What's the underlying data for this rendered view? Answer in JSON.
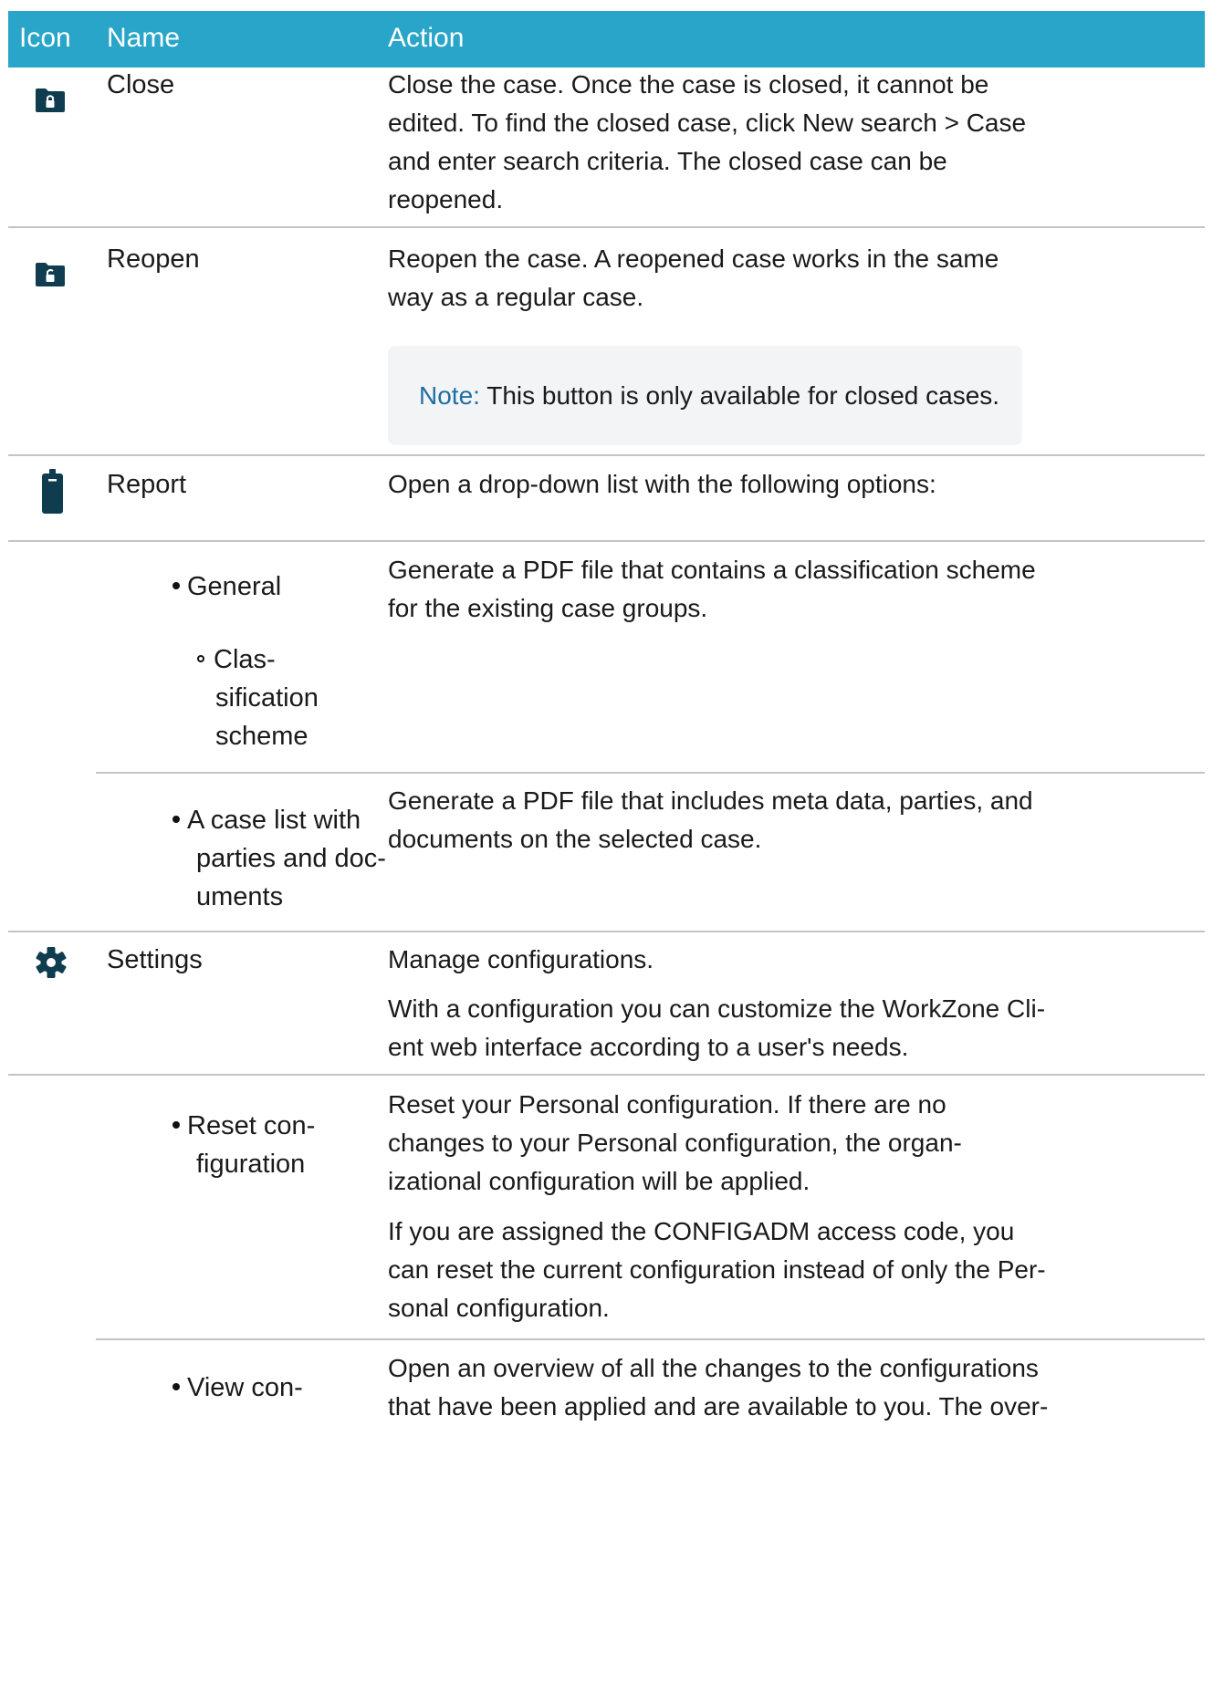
{
  "header": {
    "icon": "Icon",
    "name": "Name",
    "action": "Action"
  },
  "icons": {
    "close": "lock-folder-icon",
    "reopen": "unlock-folder-icon",
    "report": "clipboard-icon",
    "settings": "gear-icon"
  },
  "colors": {
    "header_bg": "#29a5c9",
    "icon": "#0f3d4f",
    "note_label": "#1f6fa3",
    "note_bg": "#f3f4f6"
  },
  "rows": {
    "close": {
      "name": "Close",
      "action": {
        "l1": "Close the case. Once the case is closed, it cannot be",
        "l2_pre": "edited. To find the closed case, click ",
        "l2_bold": "New search > Case",
        "l3": "and enter search criteria. The closed case can be",
        "l4": "reopened."
      }
    },
    "reopen": {
      "name": "Reopen",
      "action": {
        "l1": "Reopen the case. A reopened case works in the same",
        "l2": "way as a regular case."
      },
      "note_label": "Note:",
      "note_text": " This button is only available for closed cases."
    },
    "report": {
      "name": "Report",
      "action": "Open a drop-down list with the following options:"
    },
    "general": {
      "name": "General",
      "sub": {
        "l1": "Clas-",
        "l2": "sification",
        "l3": "scheme"
      },
      "action": {
        "l1": "Generate a PDF file that contains a classification scheme",
        "l2": "for the existing case groups."
      }
    },
    "caselist": {
      "name": {
        "l1": "A case list with",
        "l2": "parties and doc-",
        "l3": "uments"
      },
      "action": {
        "l1": "Generate a PDF file that includes meta data, parties, and",
        "l2": "documents on the selected case."
      }
    },
    "settings": {
      "name": "Settings",
      "action1": "Manage configurations.",
      "action2": {
        "l1": "With a configuration you can customize the WorkZone Cli-",
        "l2": "ent web interface according to a user's needs."
      }
    },
    "reset": {
      "name": {
        "l1": "Reset con-",
        "l2": "figuration"
      },
      "action1": {
        "l1": "Reset your Personal configuration. If there are no",
        "l2": "changes to your Personal configuration, the organ-",
        "l3": "izational configuration will be applied."
      },
      "action2": {
        "l1": "If you are assigned the CONFIGADM access code, you",
        "l2": "can reset the current configuration instead of only the Per-",
        "l3": "sonal configuration."
      }
    },
    "view": {
      "name": {
        "l1": "View con-"
      },
      "action": {
        "l1": "Open an overview of all the changes to the configurations",
        "l2": "that have been applied and are available to you. The over-"
      }
    }
  }
}
